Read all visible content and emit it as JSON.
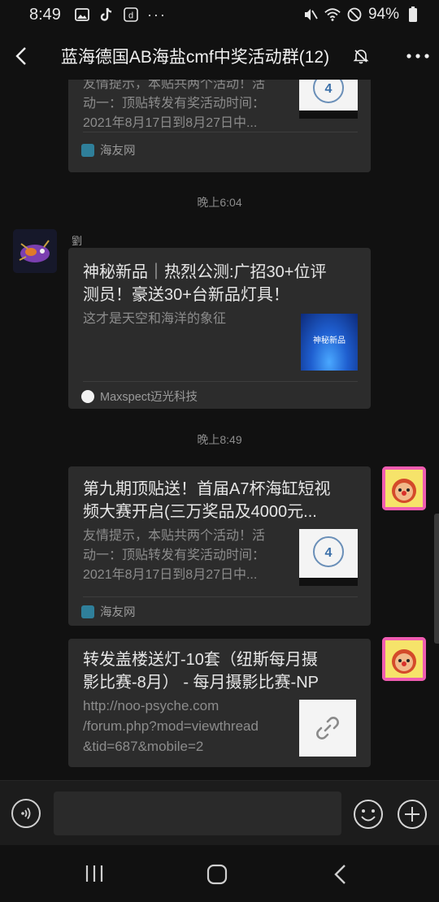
{
  "status_bar": {
    "time": "8:49",
    "battery": "94%",
    "left_icons": [
      "gallery-icon",
      "tiktok-icon",
      "douyin-icon"
    ],
    "more": "···",
    "right_icons": [
      "mute-icon",
      "wifi-icon",
      "dnd-icon",
      "battery-icon"
    ]
  },
  "header": {
    "title": "蓝海德国AB海盐cmf中奖活动群(12)",
    "back_icon": "chevron-left-icon",
    "mute_icon": "bell-off-icon",
    "more_icon": "more-dots-icon"
  },
  "messages": [
    {
      "type": "link-card",
      "side": "left",
      "desc": [
        "友情提示，本贴共两个活动！活",
        "动一：顶贴转发有奖活动时间：",
        "2021年8月17日到8月27日中..."
      ],
      "source": "海友网",
      "source_icon": "haiyou-icon"
    },
    {
      "type": "timestamp",
      "text": "晚上6:04"
    },
    {
      "type": "link-card",
      "side": "left",
      "sender": "劉",
      "title": [
        "神秘新品｜热烈公测:广招30+位评",
        "测员！豪送30+台新品灯具！"
      ],
      "desc": [
        "这才是天空和海洋的象征"
      ],
      "thumb_text": "神秘新品",
      "source": "Maxspect迈光科技",
      "source_icon": "maxspect-icon"
    },
    {
      "type": "timestamp",
      "text": "晚上8:49"
    },
    {
      "type": "link-card",
      "side": "right",
      "title": [
        "第九期顶贴送！首届A7杯海缸短视",
        "频大赛开启(三万奖品及4000元..."
      ],
      "desc": [
        "友情提示，本贴共两个活动！活",
        "动一：顶贴转发有奖活动时间：",
        "2021年8月17日到8月27日中..."
      ],
      "source": "海友网",
      "source_icon": "haiyou-icon"
    },
    {
      "type": "link-card",
      "side": "right",
      "title": [
        "转发盖楼送灯-10套（纽斯每月摄",
        "影比赛-8月） - 每月摄影比赛-NP"
      ],
      "desc": [
        "http://noo-psyche.com",
        "/forum.php?mod=viewthread",
        "&tid=687&mobile=2"
      ],
      "thumb_icon": "link-icon"
    }
  ],
  "input_bar": {
    "placeholder": "",
    "voice_icon": "voice-icon",
    "emoji_icon": "emoji-icon",
    "plus_icon": "plus-icon"
  },
  "android_nav": {
    "recent_icon": "recent-apps-icon",
    "home_icon": "home-icon",
    "back_icon": "back-icon"
  },
  "colors": {
    "background": "#111111",
    "card": "#2c2c2c",
    "card_title": "#e6e6e6",
    "card_desc": "#8c8c8c",
    "timestamp": "#8c8c8c"
  }
}
